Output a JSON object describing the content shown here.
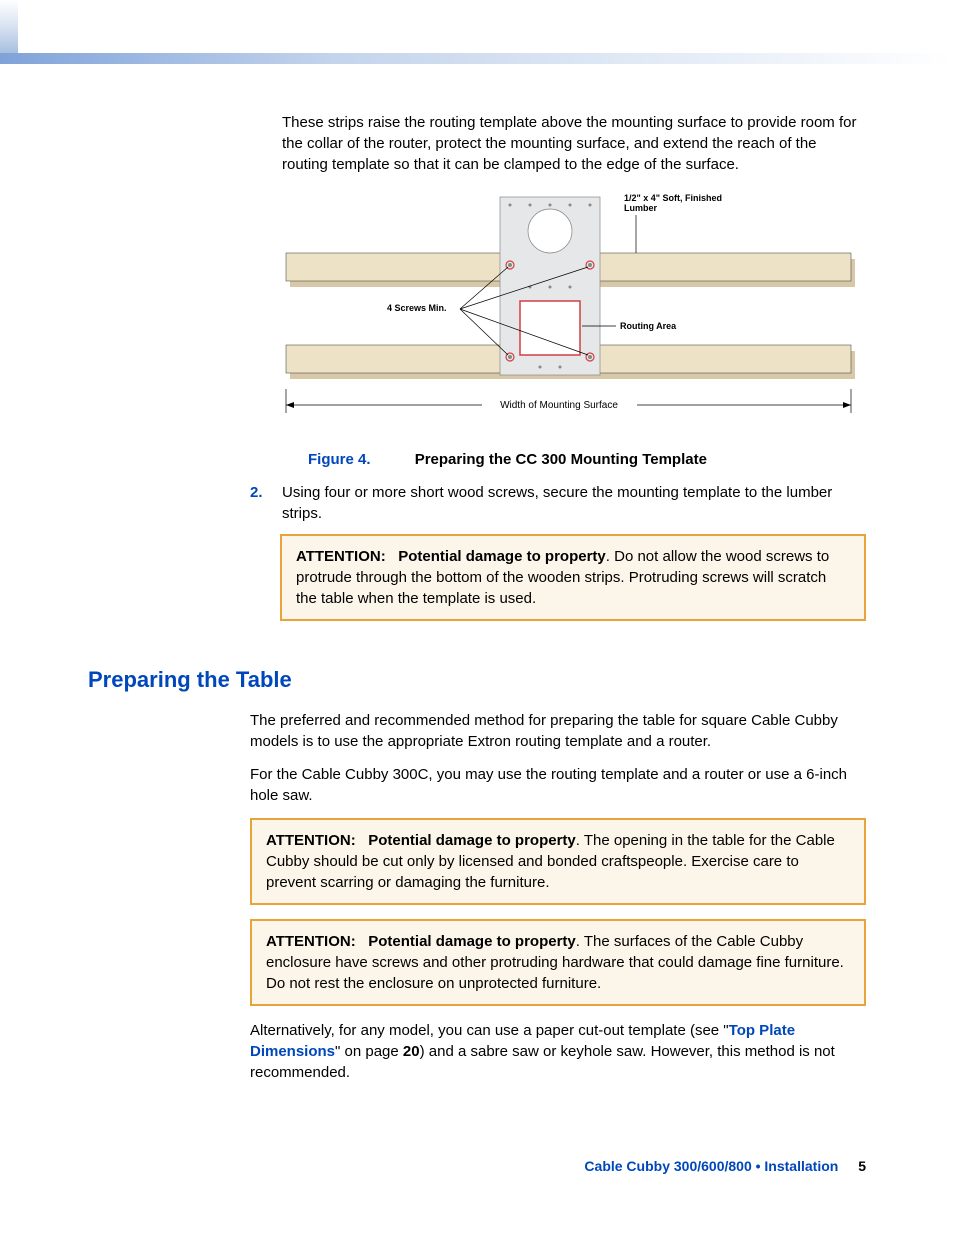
{
  "intro": "These strips raise the routing template above the mounting surface to provide room for the collar of the router, protect the mounting surface, and extend the reach of the routing template so that it can be clamped to the edge of the surface.",
  "diagram": {
    "lumber_label": "1/2\" x 4\" Soft, Finished Lumber",
    "screws_label": "4 Screws Min.",
    "routing_area_label": "Routing Area",
    "width_label": "Width of Mounting Surface"
  },
  "figure": {
    "num": "Figure 4.",
    "title": "Preparing the CC 300 Mounting Template"
  },
  "step2": {
    "num": "2.",
    "text": "Using four or more short wood screws, secure the mounting template to the lumber strips."
  },
  "attention1": {
    "label": "ATTENTION:",
    "subject": "Potential damage to property",
    "text": ". Do not allow the wood screws to protrude through the bottom of the wooden strips. Protruding screws will scratch the table when the template is used."
  },
  "section_heading": "Preparing the Table",
  "section_p1": "The preferred and recommended method for preparing the table for square Cable Cubby models is to use the appropriate Extron routing template and a router.",
  "section_p2": "For the Cable Cubby 300C, you may use the routing template and a router or use a 6-inch hole saw.",
  "attention2": {
    "label": "ATTENTION:",
    "subject": "Potential damage to property",
    "text": ". The opening in the table for the Cable Cubby should be cut only by licensed and bonded craftspeople. Exercise care to prevent scarring or damaging the furniture."
  },
  "attention3": {
    "label": "ATTENTION:",
    "subject": "Potential damage to property",
    "text": ". The surfaces of the Cable Cubby enclosure have screws and other protruding hardware that could damage fine furniture. Do not rest the enclosure on unprotected furniture."
  },
  "alt_para": {
    "pre": "Alternatively, for any model, you can use a paper cut-out template (see \"",
    "link": "Top Plate Dimensions",
    "mid": "\" on page ",
    "page": "20",
    "post": ") and a sabre saw or keyhole saw. However, this method is not recommended."
  },
  "footer": {
    "doc": "Cable Cubby 300/600/800 • Installation",
    "page": "5"
  }
}
